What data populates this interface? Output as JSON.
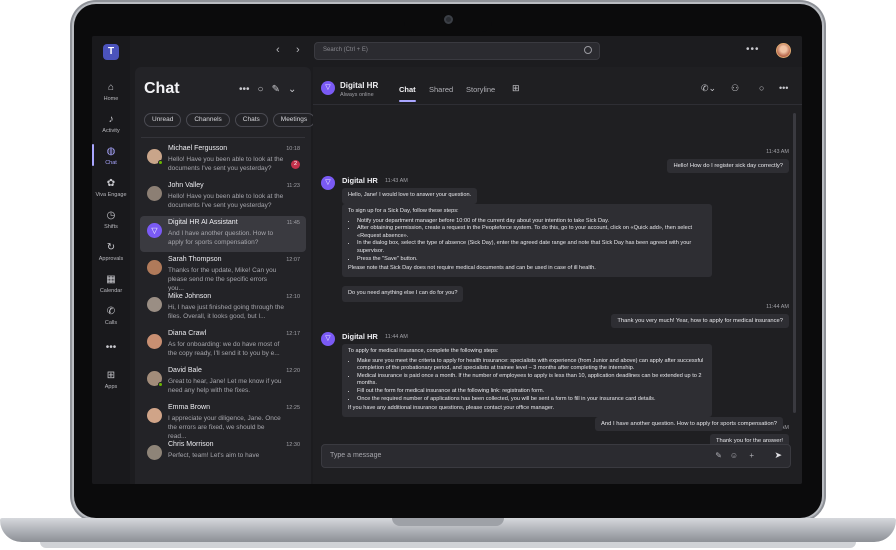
{
  "app": {
    "search_placeholder": "Search (Ctrl + E)",
    "rail": [
      {
        "label": "Home",
        "icon": "home-icon",
        "glyph": "⌂"
      },
      {
        "label": "Activity",
        "icon": "bell-icon",
        "glyph": "🔔"
      },
      {
        "label": "Chat",
        "icon": "chat-icon",
        "glyph": "💬"
      },
      {
        "label": "Viva Engage",
        "icon": "viva-engage-icon",
        "glyph": "✿"
      },
      {
        "label": "Shifts",
        "icon": "shifts-icon",
        "glyph": "◷"
      },
      {
        "label": "Approvals",
        "icon": "approvals-icon",
        "glyph": "↻"
      },
      {
        "label": "Calendar",
        "icon": "calendar-icon",
        "glyph": "▦"
      },
      {
        "label": "Calls",
        "icon": "phone-icon",
        "glyph": "✆"
      },
      {
        "label": "",
        "icon": "more-icon",
        "glyph": "•••"
      },
      {
        "label": "Apps",
        "icon": "apps-icon",
        "glyph": "⊞"
      }
    ]
  },
  "chat_list": {
    "title": "Chat",
    "filters": [
      "Unread",
      "Channels",
      "Chats",
      "Meetings"
    ],
    "items": [
      {
        "name": "Michael Fergusson",
        "time": "10:18",
        "preview": "Hello! Have you been able to look at the documents I've sent you yesterday?",
        "badge": "2",
        "color": "#c9a58a"
      },
      {
        "name": "John Valley",
        "time": "11:23",
        "preview": "Hello! Have you been able to look at the documents I've sent you yesterday?",
        "badge": "",
        "color": "#8c7f74"
      },
      {
        "name": "Digital HR AI Assistant",
        "time": "11:45",
        "preview": "And I have another question. How to apply for sports compensation?",
        "badge": "",
        "color": "#7a5af5"
      },
      {
        "name": "Sarah Thompson",
        "time": "12:07",
        "preview": "Thanks for the update, Mike! Can you please send me the specific errors you...",
        "badge": "",
        "color": "#b07a5a"
      },
      {
        "name": "Mike Johnson",
        "time": "12:10",
        "preview": "Hi, I have just finished going through the files. Overall, it looks good, but I...",
        "badge": "",
        "color": "#9a8e84"
      },
      {
        "name": "Diana Crawl",
        "time": "12:17",
        "preview": "As for onboarding: we do have most of the copy ready, I'll send it to you by e...",
        "badge": "",
        "color": "#c88f72"
      },
      {
        "name": "David Bale",
        "time": "12:20",
        "preview": "Great to hear, Jane! Let me know if you need any help with the fixes.",
        "badge": "",
        "color": "#a28c7a"
      },
      {
        "name": "Emma Brown",
        "time": "12:25",
        "preview": "I appreciate your diligence, Jane. Once the errors are fixed, we should be read...",
        "badge": "",
        "color": "#d0a488"
      },
      {
        "name": "Chris Morrison",
        "time": "12:30",
        "preview": "Perfect, team! Let's aim to have",
        "badge": "",
        "color": "#8e8478"
      }
    ]
  },
  "conversation": {
    "name": "Digital HR",
    "status": "Always online",
    "tabs": [
      "Chat",
      "Shared",
      "Storyline"
    ],
    "messages": {
      "out1_time": "11:43 AM",
      "out1": "Hello! How do I register sick day correctly?",
      "in1_sender": "Digital HR",
      "in1_time": "11:43 AM",
      "in1_greeting": "Hello, Jane! I would love to answer your question.",
      "in1_intro": "To sign up for a Sick Day, follow these steps:",
      "in1_steps": [
        "Notify your department manager before 10:00 of the current day about your intention to take Sick Day.",
        "After obtaining permission, create a request in the Peopleforce system. To do this, go to your account, click on «Quick add», then select «Request absence».",
        "In the dialog box, select the type of absence (Sick Day), enter the agreed date range and note that Sick Day has been agreed with your supervisor.",
        "Press the \"Save\" button."
      ],
      "in1_note": "Please note that Sick Day does not require medical documents and can be used in case of ill health.",
      "in1_follow": "Do you need anything else I can do for you?",
      "out2_time": "11:44 AM",
      "out2": "Thank you very much! Year, how to apply for medical insurance?",
      "in2_sender": "Digital HR",
      "in2_time": "11:44 AM",
      "in2_intro": "To apply for medical insurance, complete the following steps:",
      "in2_steps": [
        "Make sure you meet the criteria to apply for health insurance: specialists with experience (from Junior and above) can apply after successful completion of the probationary period, and specialists at trainee level – 3 months after completing the internship.",
        "Medical insurance is paid once a month. If the number of employees to apply is less than 10, application deadlines can be extended up to 2 months.",
        "Fill out the form for medical insurance at the following link: registration form.",
        "Once the required number of applications has been collected, you will be sent a form to fill in your insurance card details."
      ],
      "in2_note": "If you have any additional insurance questions, please contact your office manager.",
      "out3_time": "11:45 AM",
      "out3": "Thank you for the answer!",
      "out4": "And I have another question. How to apply for sports compensation?"
    },
    "compose_placeholder": "Type a message"
  }
}
